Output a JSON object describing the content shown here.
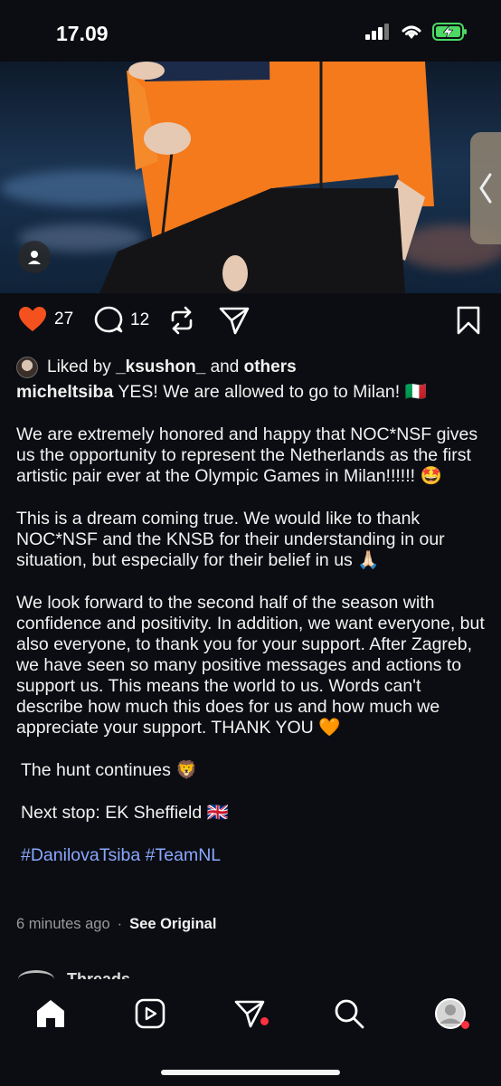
{
  "status": {
    "time": "17.09",
    "battery_color": "#4cd964"
  },
  "post": {
    "image_alt": "photo",
    "like_count": "27",
    "comment_count": "12",
    "liked_by_prefix": "Liked by",
    "liked_by_user": "_ksushon_",
    "liked_by_and": "and",
    "liked_by_others": "others",
    "username": "micheltsiba",
    "caption_lines": [
      "YES! We are allowed to go to Milan! 🇮🇹",
      "We are extremely honored and happy that NOC*NSF gives us the opportunity to represent the Netherlands as the first artistic pair ever at the Olympic Games in Milan!!!!!! 🤩",
      "This is a dream coming true. We would like to thank NOC*NSF and the KNSB for their understanding in our situation, but especially for their belief in us 🙏🏻",
      "We look forward to the second half of the season with confidence and positivity. In addition, we want everyone, but also everyone, to thank you for your support. After Zagreb, we have seen so many positive messages and actions to support us. This means the world to us. Words can't describe how much this does for us and how much we appreciate your support. THANK YOU 🧡",
      "The hunt continues 🦁",
      "Next stop: EK Sheffield 🇬🇧"
    ],
    "hashtags": "#DanilovaTsiba #TeamNL",
    "time_ago": "6 minutes ago",
    "see_original": "See Original",
    "accent_color": "#8aa8ff",
    "like_color": "#f4511e"
  },
  "next": {
    "label": "Threads"
  },
  "tabbar": {
    "items": [
      "home-icon",
      "reels-icon",
      "direct-icon",
      "search-icon",
      "profile-icon"
    ],
    "notification_color": "#ff3040"
  }
}
